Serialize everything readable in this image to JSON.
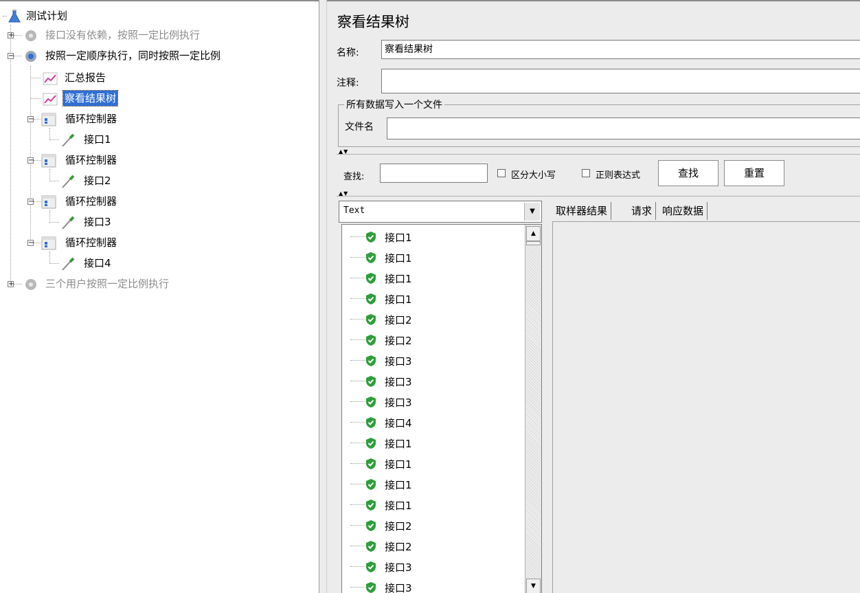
{
  "tree": {
    "root": {
      "label": "测试计划"
    },
    "groups": [
      {
        "label": "接口没有依赖，按照一定比例执行",
        "expander": "+"
      },
      {
        "label": "按照一定顺序执行，同时按照一定比例",
        "expander": "−"
      },
      {
        "label": "三个用户按照一定比例执行",
        "expander": "+"
      }
    ],
    "listeners": [
      {
        "label": "汇总报告"
      },
      {
        "label": "察看结果树"
      }
    ],
    "controllers": [
      {
        "label": "循环控制器",
        "child": "接口1"
      },
      {
        "label": "循环控制器",
        "child": "接口2"
      },
      {
        "label": "循环控制器",
        "child": "接口3"
      },
      {
        "label": "循环控制器",
        "child": "接口4"
      }
    ]
  },
  "panel": {
    "title": "察看结果树",
    "name_label": "名称:",
    "name_value": "察看结果树",
    "comment_label": "注释:",
    "comment_value": "",
    "file_group_title": "所有数据写入一个文件",
    "file_label": "文件名",
    "file_value": ""
  },
  "search": {
    "label": "查找:",
    "value": "",
    "case_label": "区分大小写",
    "regex_label": "正则表达式",
    "find_button": "查找",
    "reset_button": "重置"
  },
  "results": {
    "renderer": "Text",
    "items": [
      "接口1",
      "接口1",
      "接口1",
      "接口1",
      "接口2",
      "接口2",
      "接口3",
      "接口3",
      "接口3",
      "接口4",
      "接口1",
      "接口1",
      "接口1",
      "接口1",
      "接口2",
      "接口2",
      "接口3",
      "接口3"
    ]
  },
  "tabs": [
    "取样器结果",
    "请求",
    "响应数据"
  ],
  "colors": {
    "selection": "#2f6fd6",
    "success": "#2e9e3a"
  }
}
